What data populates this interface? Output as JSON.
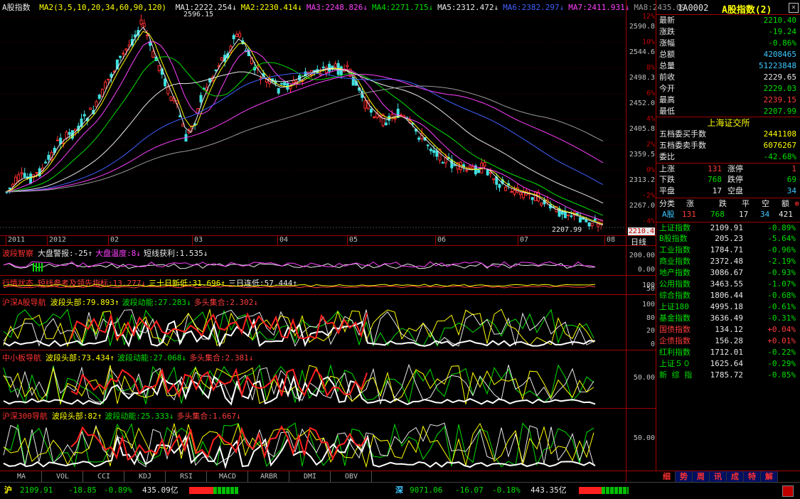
{
  "main_header": {
    "title": "A股指数",
    "ma_params": "MA2(3,5,10,20,34,60,90,120)",
    "ma": [
      {
        "label": "MA1:2222.254↓",
        "color": "#e8e8e8"
      },
      {
        "label": "MA2:2230.414↓",
        "color": "#ffff00"
      },
      {
        "label": "MA3:2248.826↓",
        "color": "#ff40ff"
      },
      {
        "label": "MA4:2271.715↓",
        "color": "#00e000"
      },
      {
        "label": "MA5:2312.472↓",
        "color": "#e8e8e8"
      },
      {
        "label": "MA6:2382.297↓",
        "color": "#4060ff"
      },
      {
        "label": "MA7:2411.931↓",
        "color": "#ff40ff"
      },
      {
        "label": "MA8:2435.09",
        "color": "#9a9a9a"
      }
    ]
  },
  "price_scale": {
    "pct": [
      "12%",
      "10%",
      "8%",
      "6%",
      "4%",
      "2%",
      "0%",
      "-2%",
      "-4%"
    ],
    "prices": [
      "2590.8",
      "2544.6",
      "2498.3",
      "2452.0",
      "2405.8",
      "2359.5",
      "2313.2",
      "2267.0",
      "2210.4"
    ]
  },
  "annotations": {
    "high": "2596.15",
    "low": "2207.99"
  },
  "date_axis": [
    "2011",
    "2012",
    "02",
    "03",
    "04",
    "05",
    "06",
    "07",
    "08"
  ],
  "period_label": "日线",
  "indicators": [
    {
      "title": "波段智察",
      "items": [
        {
          "t": "大盘警报:-25↑",
          "c": "#e8e8e8"
        },
        {
          "t": "大盘温度:8↓",
          "c": "#ff40ff"
        },
        {
          "t": "短线获利:1.535↓",
          "c": "#e8e8e8"
        }
      ],
      "scale": [
        "200.00",
        "0.00"
      ]
    },
    {
      "title": "行情状态",
      "items": [
        {
          "t": "短线参考及领先指标:13.277↓",
          "c": "#ff3c3c"
        },
        {
          "t": "三十日新低:31.696↑",
          "c": "#ffff00"
        },
        {
          "t": "三日连低:57.444↑",
          "c": "#e8e8e8"
        }
      ],
      "scale": [
        "100",
        "50"
      ]
    },
    {
      "title": "沪深A股导航",
      "items": [
        {
          "t": "波段头部:79.893↑",
          "c": "#ffff00"
        },
        {
          "t": "波段动能:27.283↓",
          "c": "#00e000"
        },
        {
          "t": "多头集合:2.302↓",
          "c": "#ff3c3c"
        }
      ],
      "scale": [
        "100",
        "80",
        "20",
        "0"
      ]
    },
    {
      "title": "中小板导航",
      "items": [
        {
          "t": "波段头部:73.434↑",
          "c": "#ffff00"
        },
        {
          "t": "波段动能:27.068↓",
          "c": "#00e000"
        },
        {
          "t": "多头集合:2.381↓",
          "c": "#ff3c3c"
        }
      ],
      "scale": [
        "50.00"
      ]
    },
    {
      "title": "沪深300导航",
      "items": [
        {
          "t": "波段头部:82↑",
          "c": "#ffff00"
        },
        {
          "t": "波段动能:25.333↓",
          "c": "#00e000"
        },
        {
          "t": "多头集合:1.667↓",
          "c": "#ff3c3c"
        }
      ],
      "scale": [
        "50.00"
      ]
    }
  ],
  "bottom_tabs": [
    "MA",
    "VOL",
    "CCI",
    "KDJ",
    "RSI",
    "MACD",
    "ARBR",
    "DMI",
    "OBV"
  ],
  "quote": {
    "code": "1A0002",
    "name": "A股指数(2)",
    "rows": [
      {
        "k": "最新",
        "v": "2210.40",
        "c": "#00e000"
      },
      {
        "k": "涨跌",
        "v": "-19.24",
        "c": "#00e000"
      },
      {
        "k": "涨幅",
        "v": "-0.86%",
        "c": "#00e000"
      },
      {
        "k": "总额",
        "v": "4208465",
        "c": "#3cc8ff"
      },
      {
        "k": "总量",
        "v": "51223848",
        "c": "#3cc8ff"
      },
      {
        "k": "前收",
        "v": "2229.65",
        "c": "#e8e8e8"
      },
      {
        "k": "今开",
        "v": "2229.03",
        "c": "#00e000"
      },
      {
        "k": "最高",
        "v": "2239.15",
        "c": "#ff3c3c"
      },
      {
        "k": "最低",
        "v": "2207.99",
        "c": "#00e000"
      }
    ],
    "exchange": "上海证交所",
    "rows2": [
      {
        "k": "五档委买手数",
        "v": "2441108",
        "c": "#ffff00"
      },
      {
        "k": "五档委卖手数",
        "v": "6076267",
        "c": "#ffff00"
      },
      {
        "k": "委比",
        "v": "-42.68%",
        "c": "#00e000"
      }
    ],
    "stats": [
      {
        "a": "上涨",
        "av": "131",
        "ac": "#ff3c3c",
        "b": "涨停",
        "bv": "1",
        "bc": "#ff3c3c"
      },
      {
        "a": "下跌",
        "av": "768",
        "ac": "#00e000",
        "b": "跌停",
        "bv": "69",
        "bc": "#00e000"
      },
      {
        "a": "平盘",
        "av": "17",
        "ac": "#e8e8e8",
        "b": "空盘",
        "bv": "34",
        "bc": "#3cc8ff"
      }
    ],
    "cat_header": {
      "a": "分类",
      "b": "涨",
      "c": "跌",
      "d": "平",
      "e": "空",
      "f": "额"
    },
    "cat_row": {
      "a": "A股",
      "b": "131",
      "c": "768",
      "d": "17",
      "e": "34",
      "f": "421"
    }
  },
  "indices": [
    {
      "n": "上证指数",
      "p": "2109.91",
      "c": "-0.89%",
      "col": "#00e000"
    },
    {
      "n": "B股指数",
      "p": "205.23",
      "c": "-5.64%",
      "col": "#00e000"
    },
    {
      "n": "工业指数",
      "p": "1784.71",
      "c": "-0.96%",
      "col": "#00e000"
    },
    {
      "n": "商业指数",
      "p": "2372.48",
      "c": "-2.19%",
      "col": "#00e000"
    },
    {
      "n": "地产指数",
      "p": "3086.67",
      "c": "-0.93%",
      "col": "#00e000"
    },
    {
      "n": "公用指数",
      "p": "3463.55",
      "c": "-1.07%",
      "col": "#00e000"
    },
    {
      "n": "综合指数",
      "p": "1806.44",
      "c": "-0.68%",
      "col": "#00e000"
    },
    {
      "n": "上证180",
      "p": "4995.18",
      "c": "-0.61%",
      "col": "#00e000"
    },
    {
      "n": "基金指数",
      "p": "3636.49",
      "c": "-0.31%",
      "col": "#00e000"
    },
    {
      "n": "国债指数",
      "p": "134.12",
      "c": "+0.04%",
      "col": "#ff3c3c"
    },
    {
      "n": "企债指数",
      "p": "156.28",
      "c": "+0.01%",
      "col": "#ff3c3c"
    },
    {
      "n": "红利指数",
      "p": "1712.01",
      "c": "-0.22%",
      "col": "#00e000"
    },
    {
      "n": "上证５０",
      "p": "1625.64",
      "c": "-0.29%",
      "col": "#00e000"
    },
    {
      "n": "新 综 指",
      "p": "1785.72",
      "c": "-0.85%",
      "col": "#00e000"
    }
  ],
  "right_tabs": [
    "细",
    "势",
    "周",
    "讯",
    "成",
    "特",
    "解"
  ],
  "status_bar": {
    "sh_label": "沪",
    "sh_value": "2109.91",
    "sh_change": "-18.85",
    "sh_pct": "-0.89%",
    "sh_amount": "435.09亿",
    "sz_label": "深",
    "sz_value": "9071.06",
    "sz_change": "-16.07",
    "sz_pct": "-0.18%",
    "sz_amount": "443.35亿"
  }
}
